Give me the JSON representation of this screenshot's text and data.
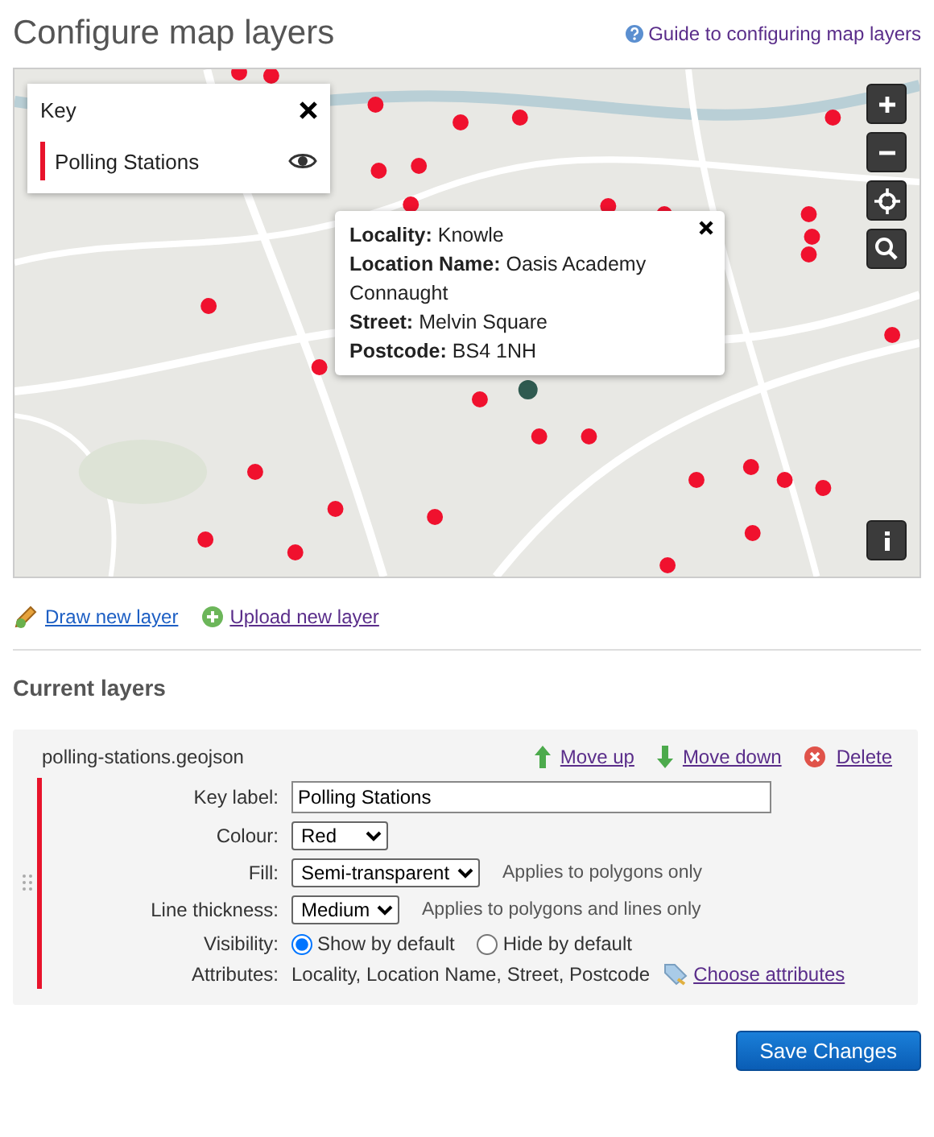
{
  "page": {
    "title": "Configure map layers",
    "guide_link": "Guide to configuring map layers"
  },
  "map": {
    "key": {
      "title": "Key",
      "items": [
        {
          "label": "Polling Stations",
          "color": "#e8132b",
          "visible": true
        }
      ]
    },
    "popup": {
      "lines": [
        "**Locality:** Knowle",
        "**Location Name:** Oasis Academy Connaught",
        "**Street:** Melvin Square",
        "**Postcode:** BS4 1NH"
      ]
    },
    "controls": [
      {
        "kind": "zoom-in"
      },
      {
        "kind": "zoom-out"
      },
      {
        "kind": "locate"
      },
      {
        "kind": "search"
      }
    ],
    "info_button": {
      "kind": "info"
    }
  },
  "actions": [
    {
      "label": "Draw new layer",
      "kind": "draw"
    },
    {
      "label": "Upload new layer",
      "kind": "upload"
    }
  ],
  "current_layers": {
    "heading": "Current layers",
    "layers": [
      {
        "file": "polling-stations.geojson",
        "color": "#e8132b",
        "links": [
          {
            "label": "Move up",
            "kind": "up"
          },
          {
            "label": "Move down",
            "kind": "down"
          },
          {
            "label": "Delete",
            "kind": "delete"
          }
        ],
        "key_label": {
          "label": "Key label:",
          "value": "Polling Stations"
        },
        "colour": {
          "label": "Colour:",
          "value": "Red"
        },
        "fill": {
          "label": "Fill:",
          "value": "Semi-transparent",
          "note": "Applies to polygons only"
        },
        "line_thickness": {
          "label": "Line thickness:",
          "value": "Medium",
          "note": "Applies to polygons and lines only"
        },
        "visibility": {
          "label": "Visibility:",
          "options": [
            {
              "label": "Show by default",
              "selected": true
            },
            {
              "label": "Hide by default",
              "selected": false
            }
          ]
        },
        "attributes": {
          "label": "Attributes:",
          "value": "Locality, Location Name, Street, Postcode",
          "link": "Choose attributes"
        }
      }
    ]
  },
  "save_button": "Save Changes"
}
